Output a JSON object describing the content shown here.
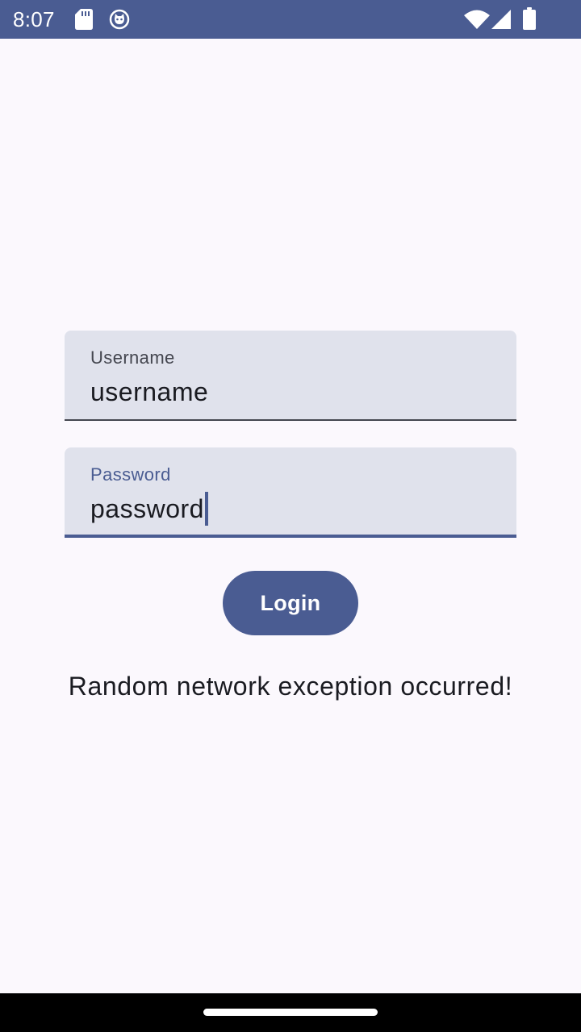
{
  "status_bar": {
    "time": "8:07",
    "background_color": "#4a5c92",
    "left_icons": [
      "sd-card-icon",
      "cat-face-icon"
    ],
    "right_icons": [
      "wifi-icon",
      "cell-signal-icon",
      "battery-icon"
    ]
  },
  "login_form": {
    "username": {
      "label": "Username",
      "value": "username"
    },
    "password": {
      "label": "Password",
      "value": "password",
      "focused": true
    },
    "login_button_label": "Login",
    "error_message": "Random network exception occurred!"
  },
  "colors": {
    "primary": "#4a5c92",
    "background": "#fbf8fd",
    "field_background": "#e0e2ec",
    "text": "#1a1b21"
  },
  "nav_bar": {
    "home_indicator": "home-indicator"
  }
}
